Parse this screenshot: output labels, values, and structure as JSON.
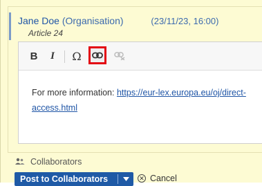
{
  "comment": {
    "author": "Jane Doe",
    "organisation": "(Organisation)",
    "timestamp": "(23/11/23, 16:00)",
    "article": "Article 24"
  },
  "toolbar": {
    "bold_label": "B",
    "italic_label": "I",
    "special_char_label": "Ω",
    "link_icon": "link-icon",
    "unlink_icon": "unlink-icon",
    "highlight_color": "#e30613"
  },
  "editor": {
    "text_prefix": "For more information: ",
    "link_text": "https://eur-lex.europa.eu/oj/direct-access.html"
  },
  "collaborators": {
    "icon": "people-icon",
    "label": "Collaborators"
  },
  "actions": {
    "post_label": "Post to Collaborators",
    "cancel_label": "Cancel"
  },
  "colors": {
    "panel_background": "#fdfbd3",
    "accent_blue": "#1f5aa6"
  }
}
